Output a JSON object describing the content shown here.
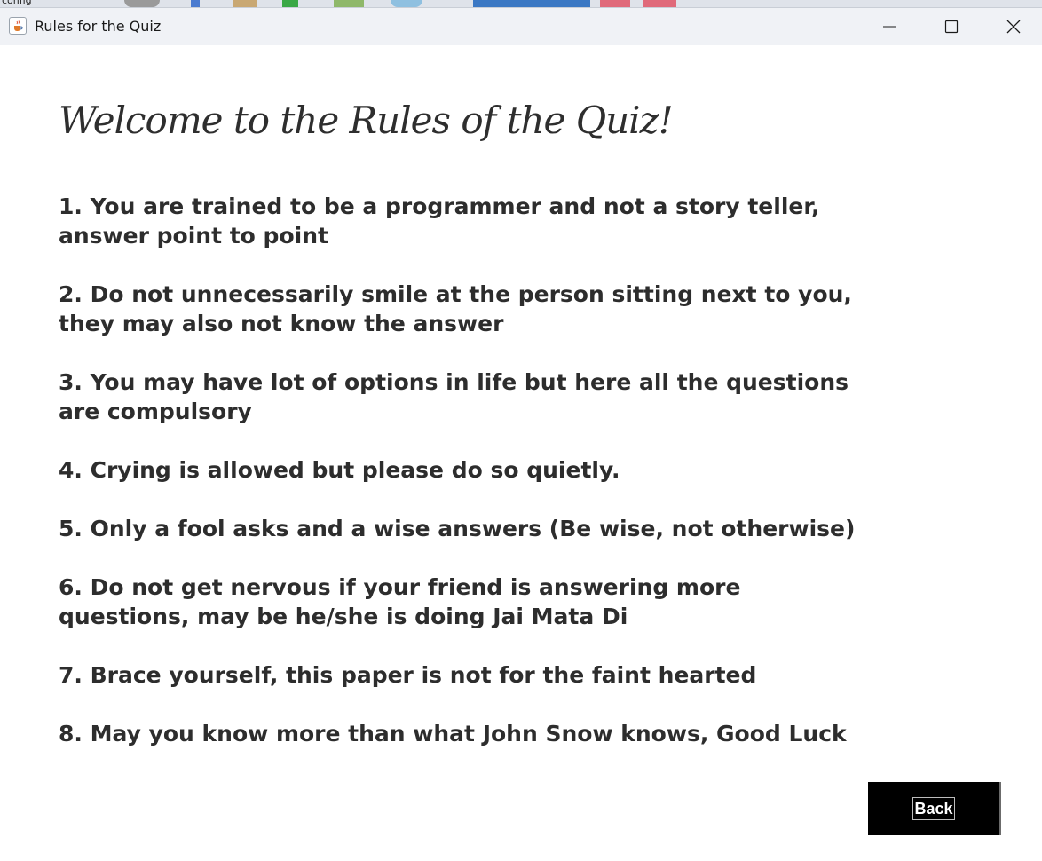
{
  "desktop": {
    "partial_label": "config"
  },
  "window": {
    "title": "Rules for the Quiz",
    "icon": "java-cup-icon",
    "controls": {
      "minimize_icon": "minimize-icon",
      "maximize_icon": "maximize-icon",
      "close_icon": "close-icon"
    }
  },
  "page": {
    "heading": "Welcome to the Rules of the Quiz!",
    "rules": [
      "1. You are trained to be a programmer and not a story teller, answer point to point",
      "2. Do not unnecessarily smile at the person sitting next to you, they may also not know the answer",
      "3. You may have lot of options in life but here all the questions are compulsory",
      "4. Crying is allowed but please do so quietly.",
      "5. Only a fool asks and a wise answers (Be wise, not otherwise)",
      "6. Do not get nervous if your friend is answering more questions, may be he/she is doing Jai Mata Di",
      "7. Brace yourself, this paper is not for the faint hearted",
      "8. May you know more than what John Snow knows, Good Luck"
    ],
    "back_button": {
      "label": "Back",
      "background": "#000000",
      "text_color": "#ffffff"
    }
  },
  "colors": {
    "titlebar": "#f0f2f6",
    "content_background": "#ffffff",
    "text": "#2d2d2d"
  }
}
